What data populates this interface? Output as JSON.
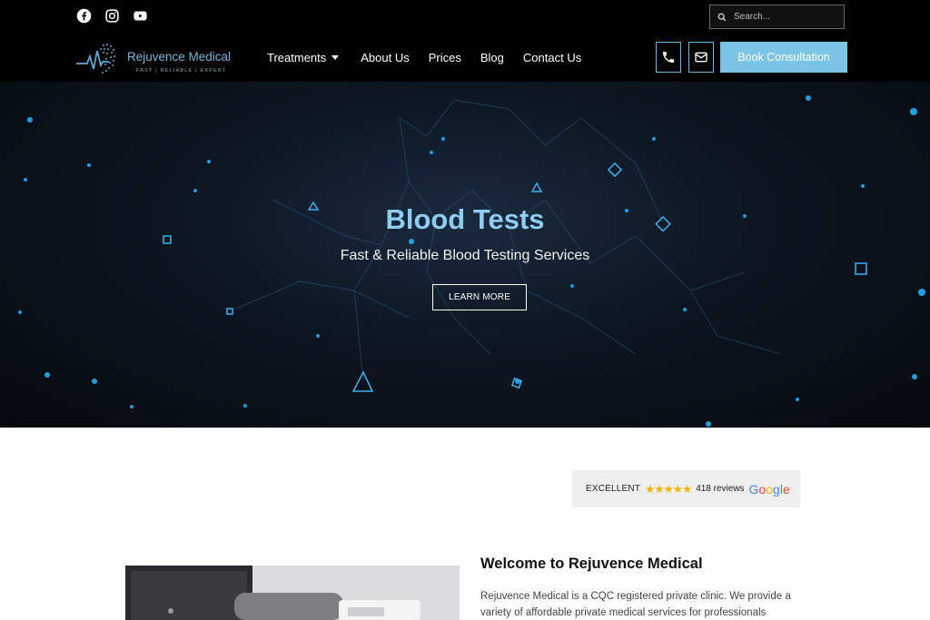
{
  "header": {
    "social": [
      "facebook-icon",
      "instagram-icon",
      "youtube-icon"
    ],
    "search": {
      "placeholder": "Search..."
    },
    "logo": {
      "name": "Rejuvence Medical",
      "tagline": "FAST | RELIABLE | EXPERT"
    },
    "nav": [
      {
        "label": "Treatments",
        "has_dropdown": true
      },
      {
        "label": "About Us"
      },
      {
        "label": "Prices"
      },
      {
        "label": "Blog"
      },
      {
        "label": "Contact Us"
      }
    ],
    "contact_icons": [
      "phone-icon",
      "envelope-icon"
    ],
    "cta": "Book Consultation"
  },
  "hero": {
    "title": "Blood Tests",
    "subtitle": "Fast & Reliable Blood Testing Services",
    "button": "LEARN MORE"
  },
  "reviews": {
    "rating_label": "EXCELLENT",
    "stars": "★★★★★",
    "count": "418 reviews",
    "provider": "Google"
  },
  "welcome": {
    "title": "Welcome to Rejuvence Medical",
    "text": "Rejuvence Medical is a CQC registered private clinic. We provide a variety of affordable private medical services for professionals"
  },
  "colors": {
    "accent": "#7cc3e8",
    "header_bg": "#000000",
    "hero_title": "#8ecdf0"
  }
}
